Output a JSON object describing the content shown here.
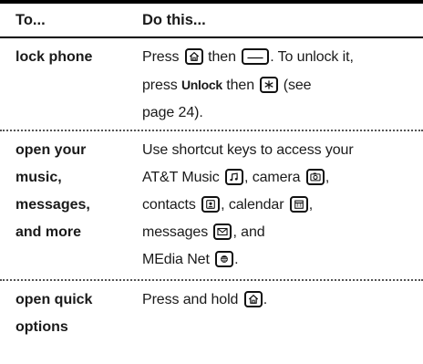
{
  "header": {
    "col1": "To...",
    "col2": "Do this..."
  },
  "rows": [
    {
      "label_lines": [
        "lock phone"
      ],
      "seg": {
        "a": "Press",
        "b": "then",
        "c": ". To unlock it,",
        "d": "press",
        "unlock": "Unlock",
        "e": "then",
        "f": "(see",
        "g": "page 24)."
      },
      "icons": [
        "home-key-icon",
        "end-key-icon",
        "star-key-icon"
      ]
    },
    {
      "label_lines": [
        "open your",
        "music,",
        "messages,",
        "and more"
      ],
      "seg": {
        "a": "Use shortcut keys to access your",
        "b": "AT&T Music",
        "c": ", camera",
        "d": ",",
        "e": "contacts",
        "f": ", calendar",
        "g": ",",
        "h": "messages",
        "i": ", and",
        "j": "MEdia Net",
        "k": "."
      },
      "icons": [
        "music-key-icon",
        "camera-key-icon",
        "contacts-key-icon",
        "calendar-key-icon",
        "messages-key-icon",
        "media-net-key-icon"
      ]
    },
    {
      "label_lines": [
        "open quick",
        "options"
      ],
      "seg": {
        "a": "Press and hold",
        "b": "."
      },
      "icons": [
        "home-key-icon"
      ]
    }
  ]
}
